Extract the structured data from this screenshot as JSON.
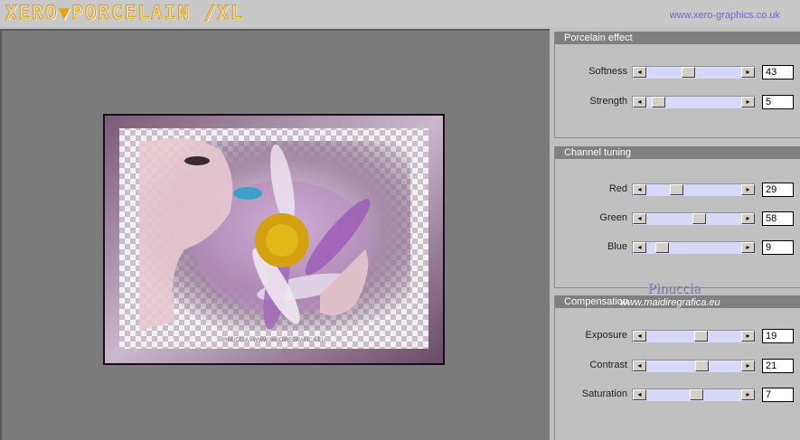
{
  "app": {
    "logo_left": "XERO",
    "logo_sep": "▼",
    "logo_right": "PORCELAIN /XL",
    "site": "www.xero-graphics.co.uk"
  },
  "groups": [
    {
      "title": "Porcelain effect",
      "rows": [
        {
          "label": "Softness",
          "value": "43"
        },
        {
          "label": "Strength",
          "value": "5"
        }
      ]
    },
    {
      "title": "Channel tuning",
      "rows": [
        {
          "label": "Red",
          "value": "29"
        },
        {
          "label": "Green",
          "value": "58"
        },
        {
          "label": "Blue",
          "value": "9"
        }
      ]
    },
    {
      "title": "Compensation",
      "rows": [
        {
          "label": "Exposure",
          "value": "19"
        },
        {
          "label": "Contrast",
          "value": "21"
        },
        {
          "label": "Saturation",
          "value": "7"
        }
      ]
    }
  ],
  "watermark": {
    "name": "Pinuccia",
    "url": "www.maidiregrafica.eu"
  },
  "preview": {
    "caption": "PINUCCIA - WWW.MAIDIREGRAFICA.EU"
  }
}
